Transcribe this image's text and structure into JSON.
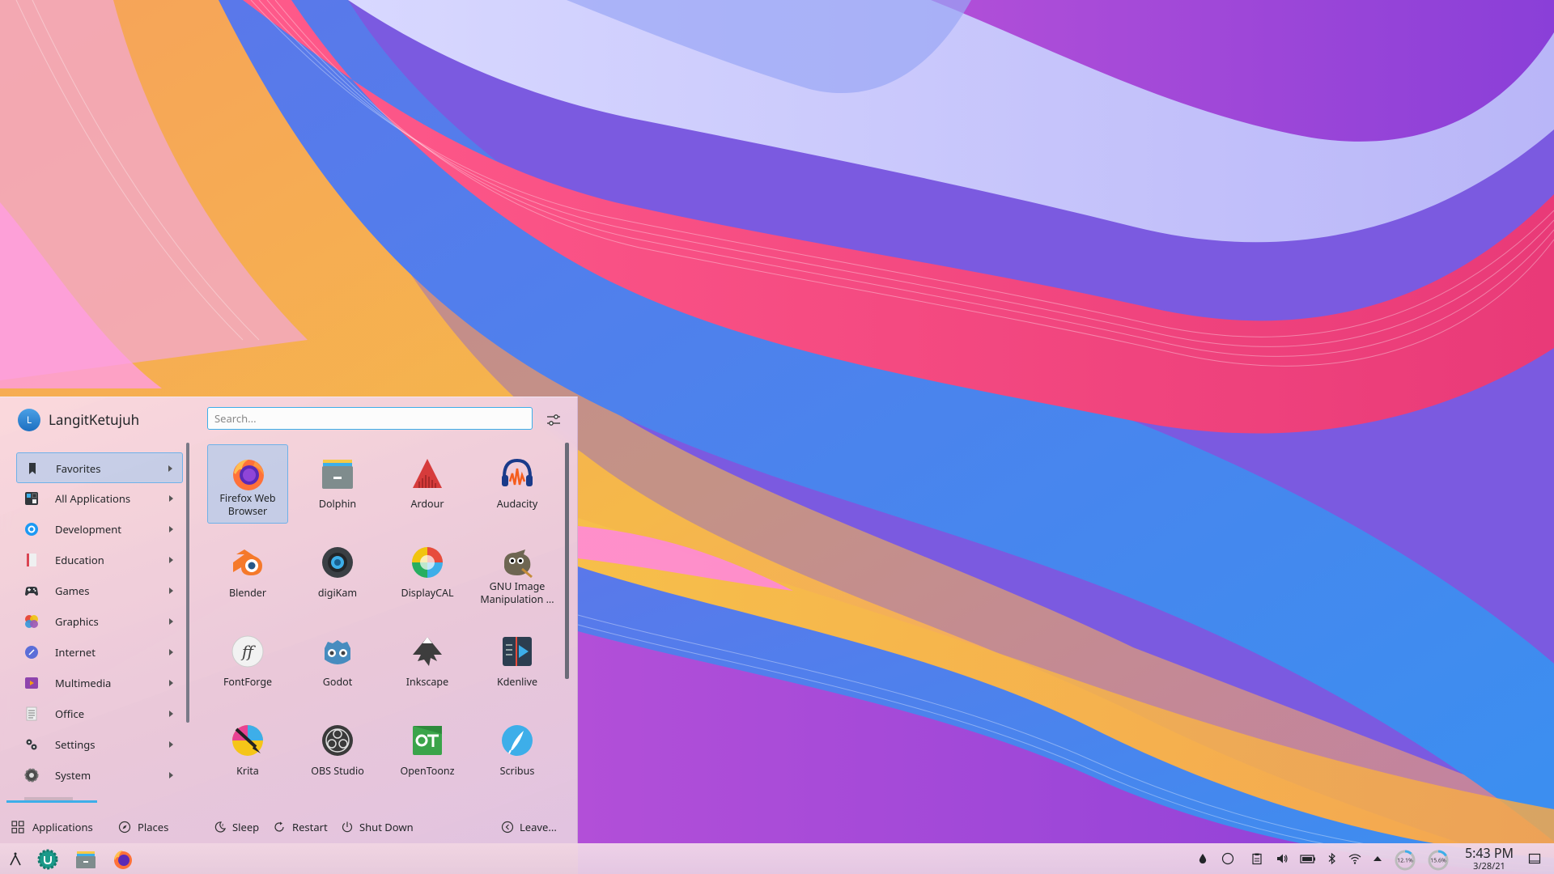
{
  "launcher": {
    "username": "LangitKetujuh",
    "avatar_letter": "L",
    "search_placeholder": "Search...",
    "categories": [
      {
        "label": "Favorites",
        "icon": "bookmark-icon"
      },
      {
        "label": "All Applications",
        "icon": "grid-icon"
      },
      {
        "label": "Development",
        "icon": "gear-blue-icon"
      },
      {
        "label": "Education",
        "icon": "book-icon"
      },
      {
        "label": "Games",
        "icon": "gamepad-icon"
      },
      {
        "label": "Graphics",
        "icon": "palette-icon"
      },
      {
        "label": "Internet",
        "icon": "globe-icon"
      },
      {
        "label": "Multimedia",
        "icon": "film-icon"
      },
      {
        "label": "Office",
        "icon": "document-icon"
      },
      {
        "label": "Settings",
        "icon": "settings-icon"
      },
      {
        "label": "System",
        "icon": "system-gear-icon"
      }
    ],
    "apps": [
      {
        "name": "Firefox Web Browser",
        "icon": "firefox-icon"
      },
      {
        "name": "Dolphin",
        "icon": "dolphin-icon"
      },
      {
        "name": "Ardour",
        "icon": "ardour-icon"
      },
      {
        "name": "Audacity",
        "icon": "audacity-icon"
      },
      {
        "name": "Blender",
        "icon": "blender-icon"
      },
      {
        "name": "digiKam",
        "icon": "digikam-icon"
      },
      {
        "name": "DisplayCAL",
        "icon": "displaycal-icon"
      },
      {
        "name": "GNU Image Manipulation ...",
        "icon": "gimp-icon"
      },
      {
        "name": "FontForge",
        "icon": "fontforge-icon"
      },
      {
        "name": "Godot",
        "icon": "godot-icon"
      },
      {
        "name": "Inkscape",
        "icon": "inkscape-icon"
      },
      {
        "name": "Kdenlive",
        "icon": "kdenlive-icon"
      },
      {
        "name": "Krita",
        "icon": "krita-icon"
      },
      {
        "name": "OBS Studio",
        "icon": "obs-icon"
      },
      {
        "name": "OpenToonz",
        "icon": "opentoonz-icon"
      },
      {
        "name": "Scribus",
        "icon": "scribus-icon"
      }
    ],
    "footer": {
      "applications": "Applications",
      "places": "Places",
      "sleep": "Sleep",
      "restart": "Restart",
      "shutdown": "Shut Down",
      "leave": "Leave..."
    }
  },
  "taskbar": {
    "time": "5:43 PM",
    "date": "3/28/21",
    "cpu": "12.1%",
    "mem": "15.6%"
  },
  "colors": {
    "accent": "#3daee9",
    "text": "#232629"
  }
}
